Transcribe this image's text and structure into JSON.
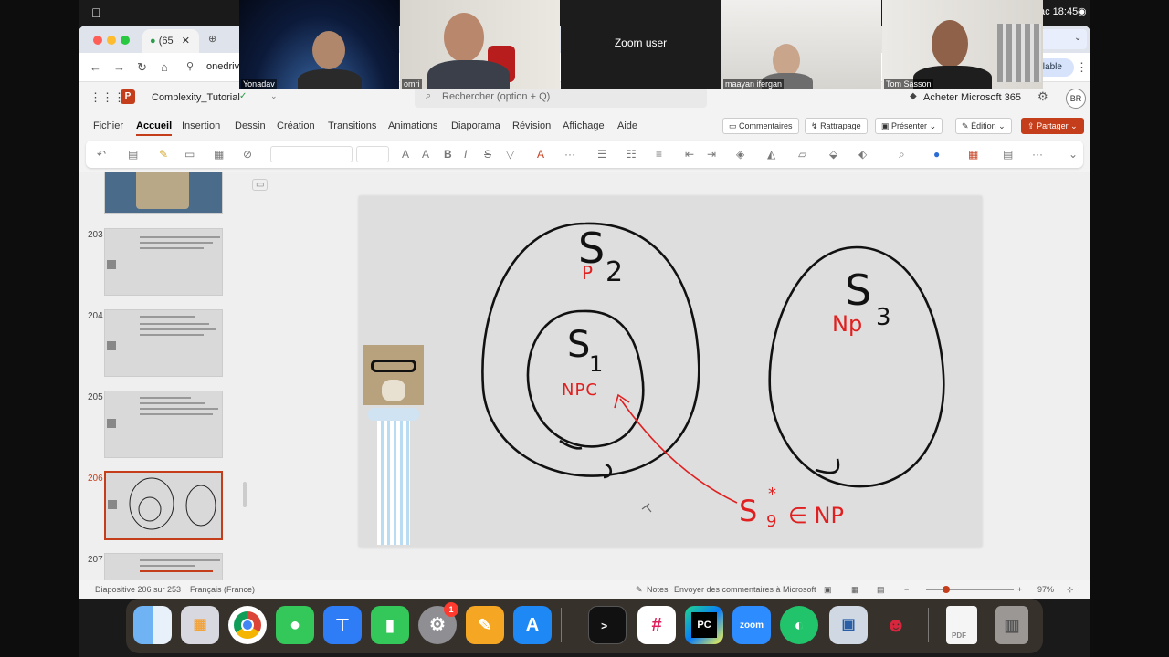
{
  "menubar": {
    "clock": "ac 18:45"
  },
  "browser": {
    "tab_label": "(65",
    "url": "onedriv",
    "app_title": "Complexity_Tutorial",
    "search_placeholder": "Rechercher (option + Q)",
    "buy_label": "Acheter Microsoft 365",
    "user_initials": "BR",
    "available_label": "ailable"
  },
  "ribbon": {
    "tabs": [
      "Fichier",
      "Accueil",
      "Insertion",
      "Dessin",
      "Création",
      "Transitions",
      "Animations",
      "Diaporama",
      "Révision",
      "Affichage",
      "Aide"
    ],
    "active_tab": "Accueil",
    "comments_label": "Commentaires",
    "catchup_label": "Rattrapage",
    "present_label": "Présenter",
    "edit_label": "Édition",
    "share_label": "Partager"
  },
  "thumbnails": [
    {
      "num": "",
      "selected": false
    },
    {
      "num": "203",
      "selected": false
    },
    {
      "num": "204",
      "selected": false
    },
    {
      "num": "205",
      "selected": false
    },
    {
      "num": "206",
      "selected": true
    },
    {
      "num": "207",
      "selected": false
    }
  ],
  "slide": {
    "s2_label": "S",
    "s2_sub": "2",
    "s2_tag": "P",
    "s1_label": "S",
    "s1_sub": "1",
    "s1_tag": "NPC",
    "s3_label": "S",
    "s3_sub": "3",
    "s3_tag": "Np",
    "s9_label": "S",
    "s9_sub": "9",
    "s9_sup": "*",
    "s9_tag": "∈ NP"
  },
  "status": {
    "slide_counter": "Diapositive 206 sur 253",
    "language": "Français (France)",
    "notes_label": "Notes",
    "feedback_label": "Envoyer des commentaires à Microsoft",
    "zoom": "97%"
  },
  "zoom_participants": [
    {
      "name": "Yonadav"
    },
    {
      "name": "omri"
    },
    {
      "name": "Zoom user"
    },
    {
      "name": "maayan ifergan"
    },
    {
      "name": "Tom Sasson"
    }
  ],
  "dock": {
    "badge_count": "1",
    "apps": [
      "finder",
      "launchpad",
      "chrome",
      "messages",
      "keynote",
      "numbers",
      "settings",
      "pages",
      "app-store",
      "terminal",
      "slack",
      "pycharm",
      "zoom",
      "robinhood",
      "preview",
      "drama",
      "pdf",
      "trash"
    ]
  },
  "colors": {
    "accent": "#c43e1c",
    "ink": "#111111",
    "red_ink": "#e02020"
  }
}
